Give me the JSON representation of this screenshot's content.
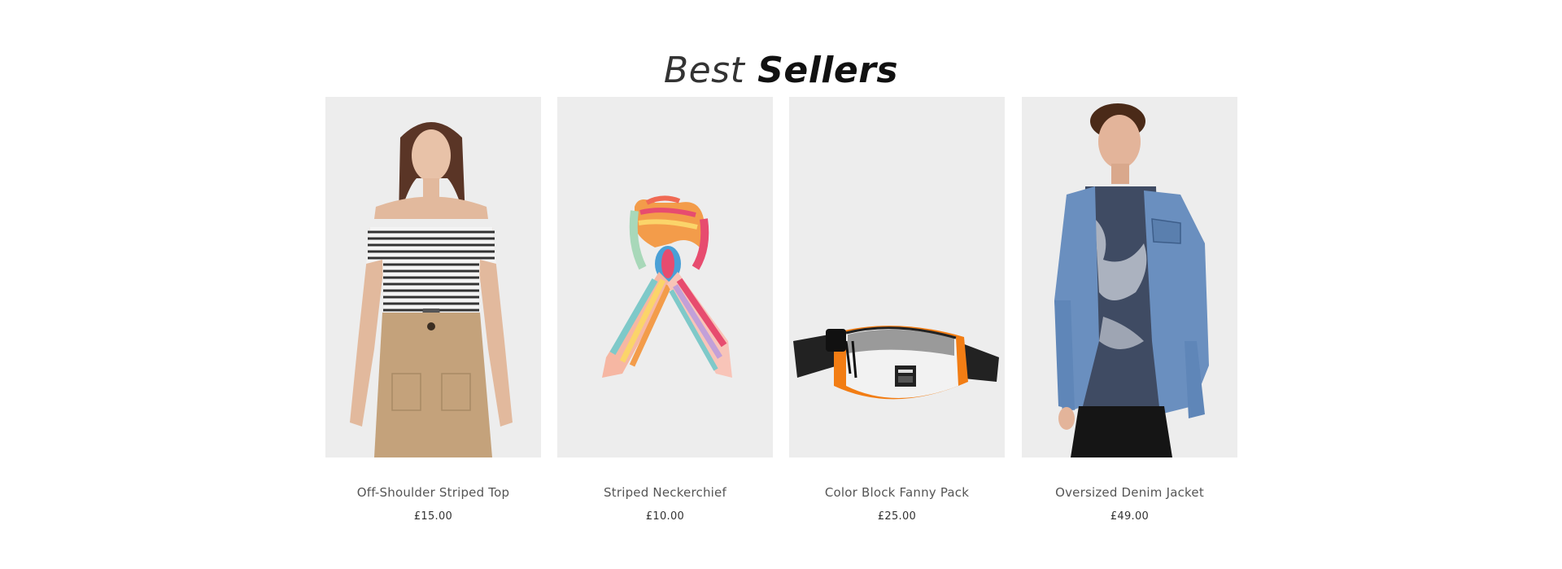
{
  "section": {
    "title_light": "Best",
    "title_bold": "Sellers"
  },
  "products": [
    {
      "name": "Off-Shoulder Striped Top",
      "price": "£15.00",
      "image_icon": "woman-striped-top-image"
    },
    {
      "name": "Striped Neckerchief",
      "price": "£10.00",
      "image_icon": "neckerchief-image"
    },
    {
      "name": "Color Block Fanny Pack",
      "price": "£25.00",
      "image_icon": "fanny-pack-image"
    },
    {
      "name": "Oversized Denim Jacket",
      "price": "£49.00",
      "image_icon": "man-denim-jacket-image"
    }
  ],
  "colors": {
    "image_bg": "#ededed",
    "title": "#111111",
    "product_name": "#555555",
    "price": "#333333"
  }
}
